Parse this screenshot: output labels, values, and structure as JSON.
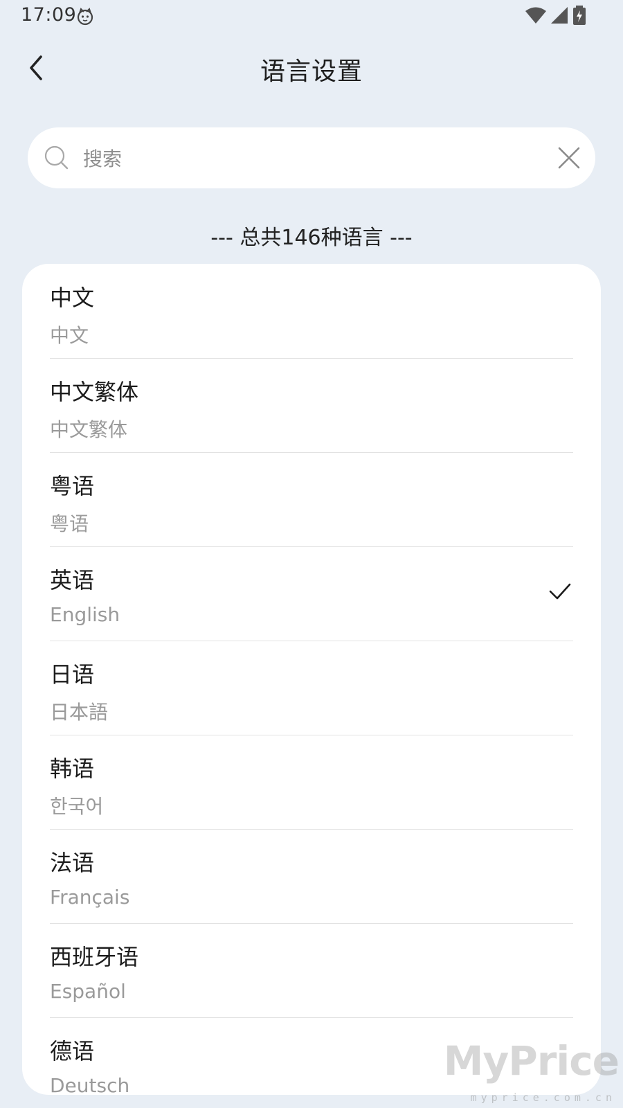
{
  "status_bar": {
    "time": "17:09"
  },
  "header": {
    "title": "语言设置"
  },
  "search": {
    "placeholder": "搜索",
    "value": ""
  },
  "list": {
    "total_label": "--- 总共146种语言 ---",
    "items": [
      {
        "name": "中文",
        "native": "中文",
        "selected": false
      },
      {
        "name": "中文繁体",
        "native": "中文繁体",
        "selected": false
      },
      {
        "name": "粤语",
        "native": "粤语",
        "selected": false
      },
      {
        "name": "英语",
        "native": "English",
        "selected": true
      },
      {
        "name": "日语",
        "native": "日本語",
        "selected": false
      },
      {
        "name": "韩语",
        "native": "한국어",
        "selected": false
      },
      {
        "name": "法语",
        "native": "Français",
        "selected": false
      },
      {
        "name": "西班牙语",
        "native": "Español",
        "selected": false
      },
      {
        "name": "德语",
        "native": "Deutsch",
        "selected": false
      }
    ]
  },
  "watermark": {
    "brand": "MyPrice",
    "domain": "myprice.com.cn"
  },
  "colors": {
    "background": "#e8eef5",
    "card": "#ffffff",
    "primary_text": "#1c1c1c",
    "secondary_text": "#9a9a9a",
    "divider": "#e2e2e2"
  }
}
